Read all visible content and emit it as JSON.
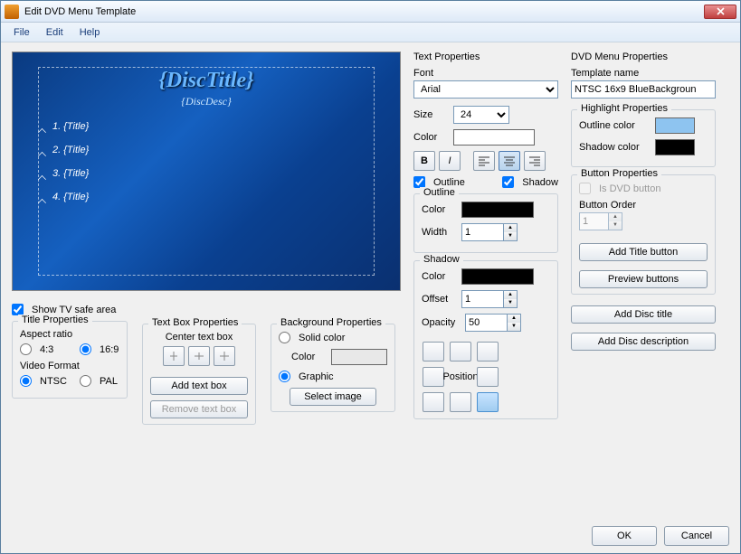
{
  "window": {
    "title": "Edit DVD Menu Template"
  },
  "menu": {
    "file": "File",
    "edit": "Edit",
    "help": "Help"
  },
  "preview": {
    "disc_title": "{DiscTitle}",
    "disc_desc": "{DiscDesc}",
    "title1": "1. {Title}",
    "title2": "2. {Title}",
    "title3": "3. {Title}",
    "title4": "4. {Title}"
  },
  "tvsafe": {
    "label": "Show TV safe area",
    "checked": true
  },
  "title_props": {
    "heading": "Title Properties",
    "aspect_label": "Aspect ratio",
    "aspect_43": "4:3",
    "aspect_169": "16:9",
    "aspect_value": "16:9",
    "video_label": "Video Format",
    "ntsc": "NTSC",
    "pal": "PAL",
    "video_value": "NTSC"
  },
  "tb_props": {
    "heading": "Text Box Properties",
    "center_label": "Center text box",
    "add": "Add text box",
    "remove": "Remove text box"
  },
  "bg_props": {
    "heading": "Background Properties",
    "solid": "Solid color",
    "color": "Color",
    "graphic": "Graphic",
    "select": "Select image",
    "value": "Graphic"
  },
  "text_props": {
    "heading": "Text Properties",
    "font_label": "Font",
    "font_value": "Arial",
    "size_label": "Size",
    "size_value": "24",
    "color_label": "Color",
    "color_value": "#ffffff",
    "bold": "B",
    "italic": "I",
    "outline_chk": "Outline",
    "outline_checked": true,
    "shadow_chk": "Shadow",
    "shadow_checked": true,
    "outline_heading": "Outline",
    "outline_color_label": "Color",
    "outline_color": "#000000",
    "width_label": "Width",
    "width_value": "1",
    "shadow_heading": "Shadow",
    "shadow_color_label": "Color",
    "shadow_color": "#000000",
    "offset_label": "Offset",
    "offset_value": "1",
    "opacity_label": "Opacity",
    "opacity_value": "50",
    "position_label": "Position"
  },
  "dvd_props": {
    "heading": "DVD Menu Properties",
    "template_label": "Template name",
    "template_value": "NTSC 16x9 BlueBackgroun",
    "highlight_heading": "Highlight Properties",
    "outline_color_label": "Outline color",
    "outline_color": "#8ec4f0",
    "shadow_color_label": "Shadow color",
    "shadow_color": "#000000",
    "button_heading": "Button Properties",
    "is_dvd_label": "Is DVD button",
    "is_dvd_checked": false,
    "order_label": "Button Order",
    "order_value": "1",
    "add_title_btn": "Add Title button",
    "preview_btn": "Preview buttons",
    "add_disc_title": "Add Disc title",
    "add_disc_desc": "Add Disc description"
  },
  "footer": {
    "ok": "OK",
    "cancel": "Cancel"
  }
}
